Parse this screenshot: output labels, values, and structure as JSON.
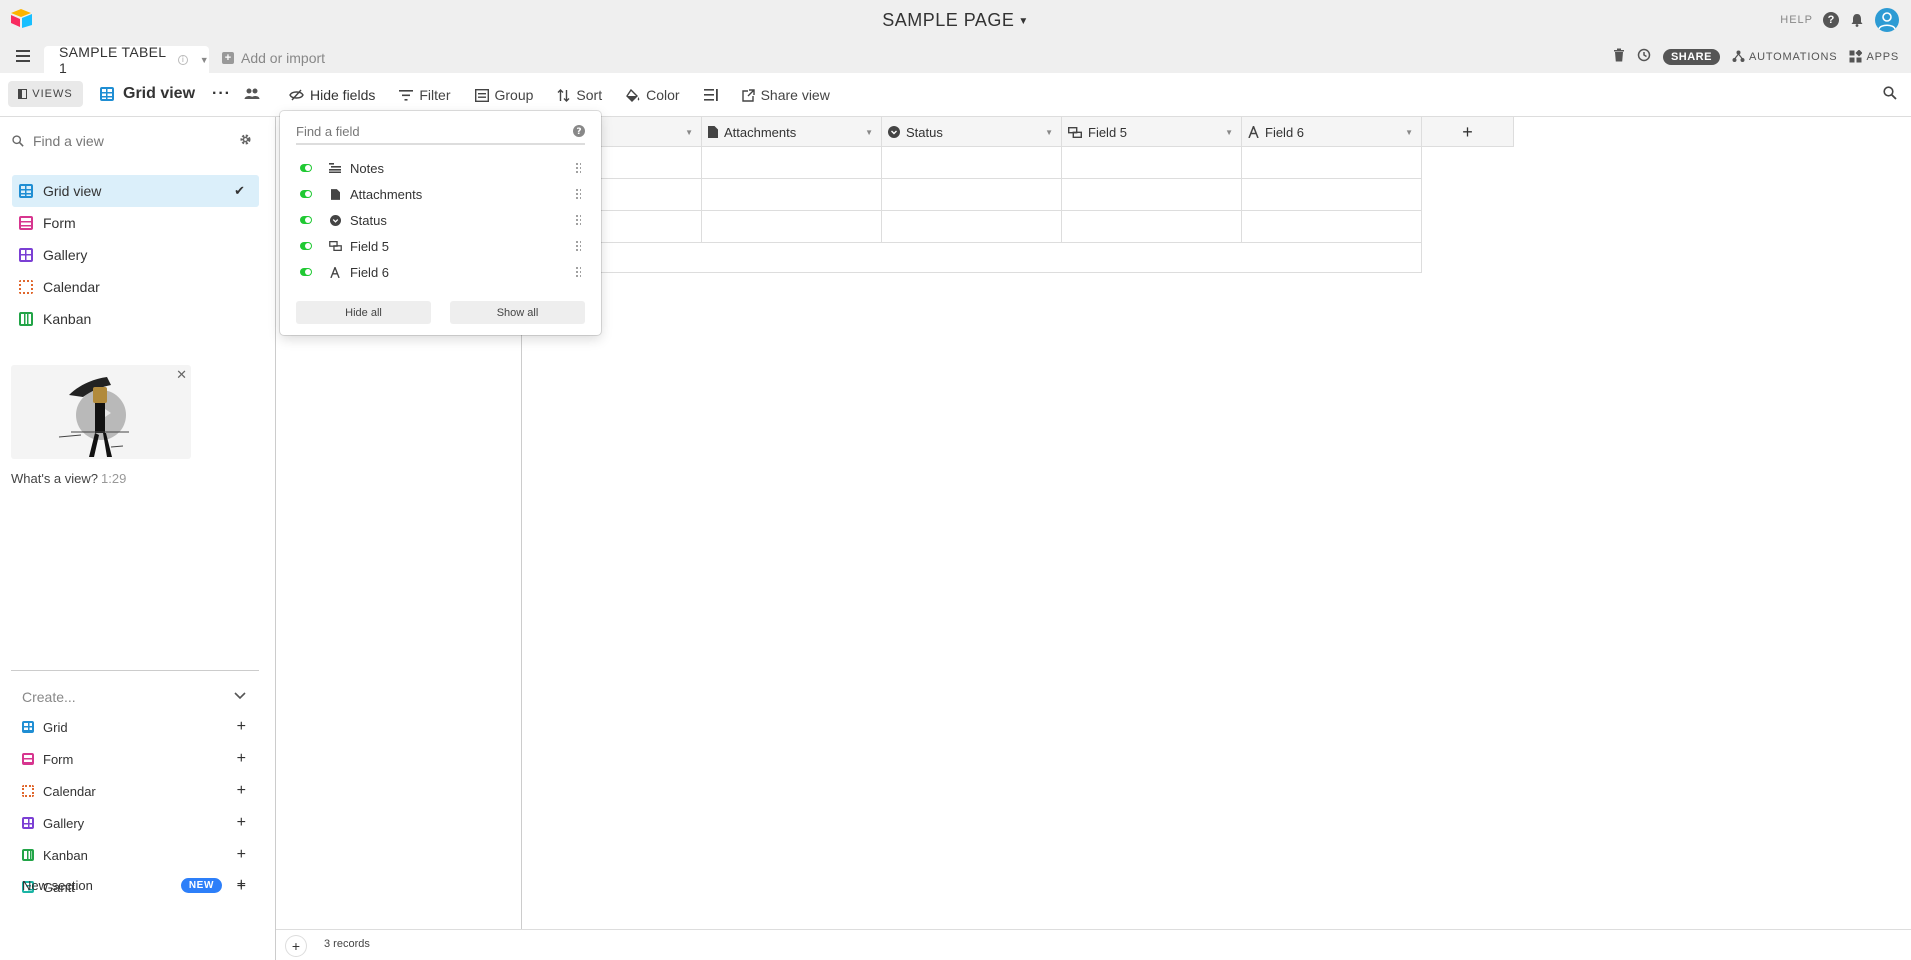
{
  "app": {
    "page_title": "SAMPLE PAGE",
    "help_label": "HELP"
  },
  "tabs": {
    "active_tab": "SAMPLE TABEL 1",
    "add_import": "Add or import"
  },
  "header_right": {
    "share": "SHARE",
    "automations": "AUTOMATIONS",
    "apps": "APPS"
  },
  "viewbar": {
    "views_label": "VIEWS",
    "current_view": "Grid view",
    "toolbar": {
      "hide_fields": "Hide fields",
      "filter": "Filter",
      "group": "Group",
      "sort": "Sort",
      "color": "Color",
      "share_view": "Share view"
    }
  },
  "sidebar": {
    "find_placeholder": "Find a view",
    "views": [
      {
        "label": "Grid view",
        "icon": "grid-icon",
        "active": true
      },
      {
        "label": "Form",
        "icon": "form-icon"
      },
      {
        "label": "Gallery",
        "icon": "gallery-icon"
      },
      {
        "label": "Calendar",
        "icon": "calendar-icon"
      },
      {
        "label": "Kanban",
        "icon": "kanban-icon"
      }
    ],
    "video": {
      "caption": "What's a view?",
      "duration": "1:29"
    },
    "create": {
      "heading": "Create...",
      "items": [
        {
          "label": "Grid",
          "icon": "grid-icon"
        },
        {
          "label": "Form",
          "icon": "form-icon"
        },
        {
          "label": "Calendar",
          "icon": "calendar-icon"
        },
        {
          "label": "Gallery",
          "icon": "gallery-icon"
        },
        {
          "label": "Kanban",
          "icon": "kanban-icon"
        },
        {
          "label": "Gantt",
          "icon": "gantt-icon"
        }
      ],
      "new_section": "New section",
      "new_badge": "NEW"
    }
  },
  "grid": {
    "columns": [
      {
        "label": "",
        "icon": ""
      },
      {
        "label": "Attachments",
        "icon": "document-icon"
      },
      {
        "label": "Status",
        "icon": "status-icon"
      },
      {
        "label": "Field 5",
        "icon": "link-icon"
      },
      {
        "label": "Field 6",
        "icon": "text-icon"
      }
    ],
    "record_count": "3 records"
  },
  "hide_fields_popover": {
    "search_placeholder": "Find a field",
    "fields": [
      {
        "label": "Notes",
        "icon": "long-text-icon",
        "visible": true
      },
      {
        "label": "Attachments",
        "icon": "document-icon",
        "visible": true
      },
      {
        "label": "Status",
        "icon": "status-icon",
        "visible": true
      },
      {
        "label": "Field 5",
        "icon": "link-icon",
        "visible": true
      },
      {
        "label": "Field 6",
        "icon": "text-icon",
        "visible": true
      }
    ],
    "hide_all": "Hide all",
    "show_all": "Show all"
  },
  "colors": {
    "accent": "#2d7ff9",
    "toggle_on": "#20c933",
    "active_view_bg": "#dbeffa"
  }
}
